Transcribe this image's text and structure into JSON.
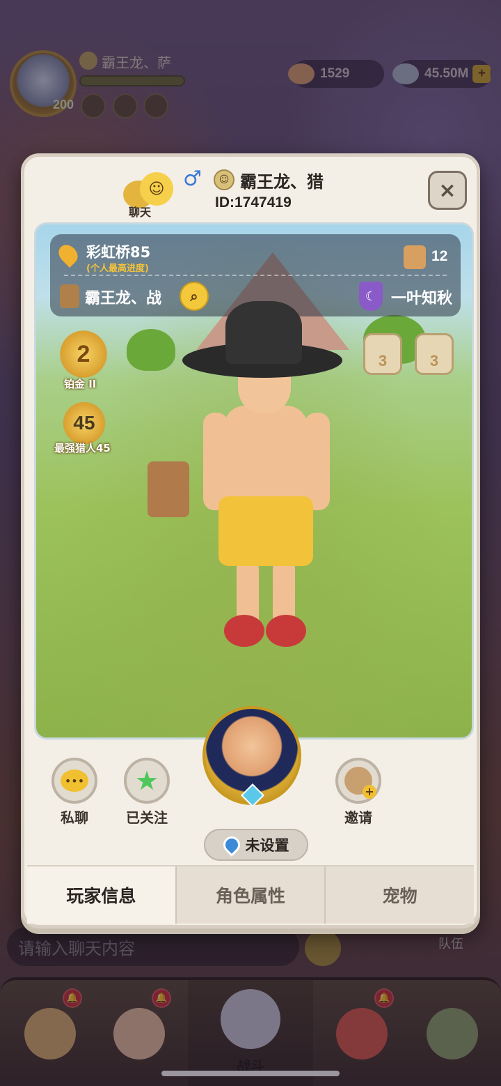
{
  "hud": {
    "player_name": "霸王龙、萨",
    "level": "200",
    "currency_1": "1529",
    "currency_2": "45.50M",
    "plus_label": "+"
  },
  "chat_input": {
    "placeholder": "请输入聊天内容"
  },
  "side_label_team": "队伍",
  "bottom_nav": {
    "battle_label": "战斗",
    "badge_icon": "bell-icon"
  },
  "modal": {
    "chat_label": "聊天",
    "gender_icon": "male-icon",
    "name": "霸王龙、猎",
    "id": "ID:1747419",
    "close_icon": "×",
    "info": {
      "stage": "彩虹桥85",
      "stage_sub": "(个人最高进度)",
      "likes": "12",
      "guild": "霸王龙、战",
      "clan": "一叶知秋"
    },
    "rank": {
      "value": "2",
      "label": "铂金 II"
    },
    "hunter": {
      "value": "45",
      "label": "最强猎人45"
    },
    "stats": [
      "3",
      "3"
    ],
    "actions": {
      "private_chat": "私聊",
      "followed": "已关注",
      "invite": "邀请"
    },
    "location": "未设置",
    "tabs": [
      "玩家信息",
      "角色属性",
      "宠物"
    ],
    "active_tab": 0
  }
}
